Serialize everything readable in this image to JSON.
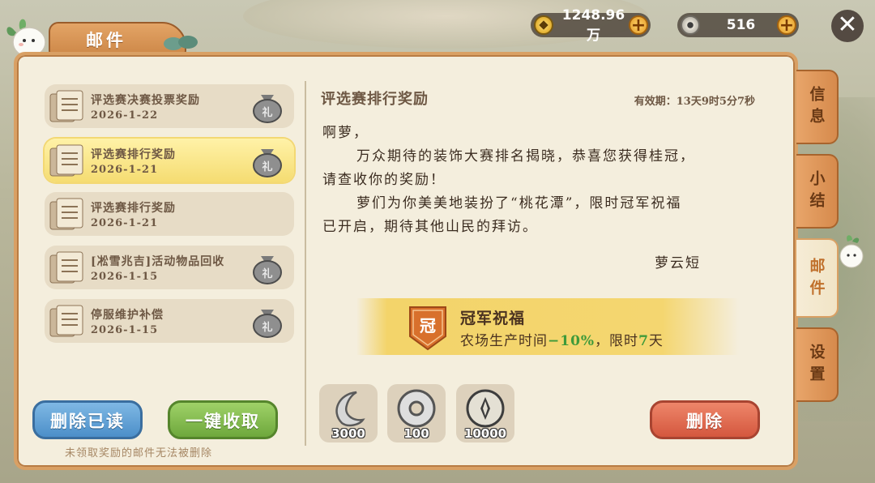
{
  "header": {
    "title": "邮件",
    "gold": "1248.96万",
    "coins": "516",
    "plus": "+",
    "close": "✕"
  },
  "mail_list": [
    {
      "title": "评选赛决赛投票奖励",
      "date": "2026-1-22",
      "selected": false
    },
    {
      "title": "评选赛排行奖励",
      "date": "2026-1-21",
      "selected": true
    },
    {
      "title": "评选赛排行奖励",
      "date": "2026-1-21",
      "selected": false
    },
    {
      "title": "[凇雪兆吉]活动物品回收",
      "date": "2026-1-15",
      "selected": false
    },
    {
      "title": "停服维护补偿",
      "date": "2026-1-15",
      "selected": false
    }
  ],
  "buttons": {
    "delete_read": "删除已读",
    "collect_all": "一键收取",
    "delete": "删除"
  },
  "hint": "未领取奖励的邮件无法被删除",
  "mail_detail": {
    "subject": "评选赛排行奖励",
    "validity": "有效期：13天9时5分7秒",
    "greeting": "啊萝，",
    "line1": "万众期待的装饰大赛排名揭晓，恭喜您获得桂冠，",
    "line2": "请查收你的奖励！",
    "line3": "萝们为你美美地装扮了“桃花潭”，限时冠军祝福",
    "line4": "已开启，期待其他山民的拜访。",
    "signature": "萝云短"
  },
  "blessing": {
    "badge": "冠",
    "title": "冠军祝福",
    "desc_prefix": "农场生产时间",
    "desc_value": "−10%",
    "desc_mid": "，限时",
    "desc_days": "7",
    "desc_suffix": "天"
  },
  "rewards": [
    {
      "icon": "moon-icon",
      "count": "3000"
    },
    {
      "icon": "silver-coin-icon",
      "count": "100"
    },
    {
      "icon": "copper-coin-icon",
      "count": "10000"
    }
  ],
  "side_tabs": [
    {
      "label": "信息",
      "active": false
    },
    {
      "label": "小结",
      "active": false
    },
    {
      "label": "邮件",
      "active": true
    },
    {
      "label": "设置",
      "active": false
    }
  ],
  "colors": {
    "panel": "#f4eedd",
    "accent_orange": "#d9a064",
    "selected_mail": "#f5dc72",
    "green_value": "#3f9a3a"
  }
}
